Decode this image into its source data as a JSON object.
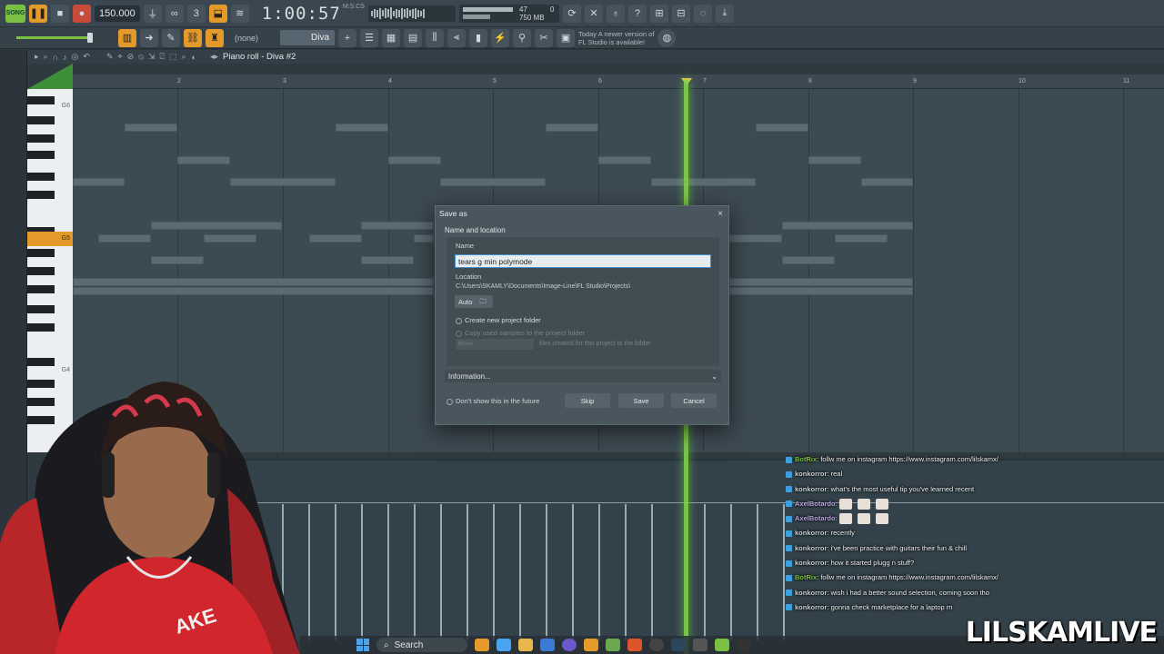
{
  "toolbar": {
    "song_label": "SONG",
    "tempo": "150.000",
    "time": "1:00:57",
    "time_unit": "M:S:CS",
    "cpu": "47",
    "memory": "750 MB",
    "memory_sub": "0",
    "news_line1": "Today  A newer version of",
    "news_line2": "FL Studio is available!"
  },
  "toolbar2": {
    "snap": "(none)",
    "pattern": "Diva"
  },
  "piano_roll": {
    "title": "Piano roll - Diva #2",
    "bars": [
      "2",
      "3",
      "4",
      "5",
      "6",
      "7",
      "8",
      "9",
      "10",
      "11"
    ],
    "key_labels": {
      "g6": "G6",
      "g5": "G5",
      "g4": "G4"
    }
  },
  "dialog": {
    "title": "Save as",
    "close": "×",
    "section": "Name and location",
    "name_label": "Name",
    "name_value": "tears g min polymode",
    "location_label": "Location",
    "location_path": "C:\\Users\\SKAMLY\\Documents\\Image-Line\\FL Studio\\Projects\\",
    "auto_button": "Auto",
    "create_folder": "Create new project folder",
    "copy_samples": "Copy used samples to the project folder",
    "move_button": "Move",
    "move_text": "files created for this project to the folder",
    "information": "Information...",
    "dont_show": "Don't show this in the future",
    "skip": "Skip",
    "save": "Save",
    "cancel": "Cancel"
  },
  "chat": [
    {
      "user": "BotRix",
      "text": ": follw me on instagram https://www.instagram.com/lilskamx/",
      "kind": "bot"
    },
    {
      "user": "konkorror",
      "text": ": real",
      "kind": "k"
    },
    {
      "user": "konkorror",
      "text": ": what's the most useful tip you've learned recent",
      "kind": "k"
    },
    {
      "user": "AxelBotardo",
      "text": ":",
      "kind": "ax",
      "emotes": 3
    },
    {
      "user": "AxelBotardo",
      "text": ":",
      "kind": "ax",
      "emotes": 3
    },
    {
      "user": "konkorror",
      "text": ": recently",
      "kind": "k"
    },
    {
      "user": "konkorror",
      "text": ": i've been practice with guitars their fun & chill",
      "kind": "k"
    },
    {
      "user": "konkorror",
      "text": ": how it started plugg n stuff?",
      "kind": "k"
    },
    {
      "user": "BotRix",
      "text": ": follw me on instagram https://www.instagram.com/lilskamx/",
      "kind": "bot"
    },
    {
      "user": "konkorror",
      "text": ": wish i had a better sound selection, coming soon tho",
      "kind": "k"
    },
    {
      "user": "konkorror",
      "text": ": gonna check marketplace for a laptop rn",
      "kind": "k"
    }
  ],
  "watermark": "LILSKAMLIVE",
  "taskbar": {
    "search": "Search"
  },
  "colors": {
    "accent_orange": "#e39a2b",
    "playhead_green": "#7fd34e",
    "focus_blue": "#3f8fd6"
  }
}
